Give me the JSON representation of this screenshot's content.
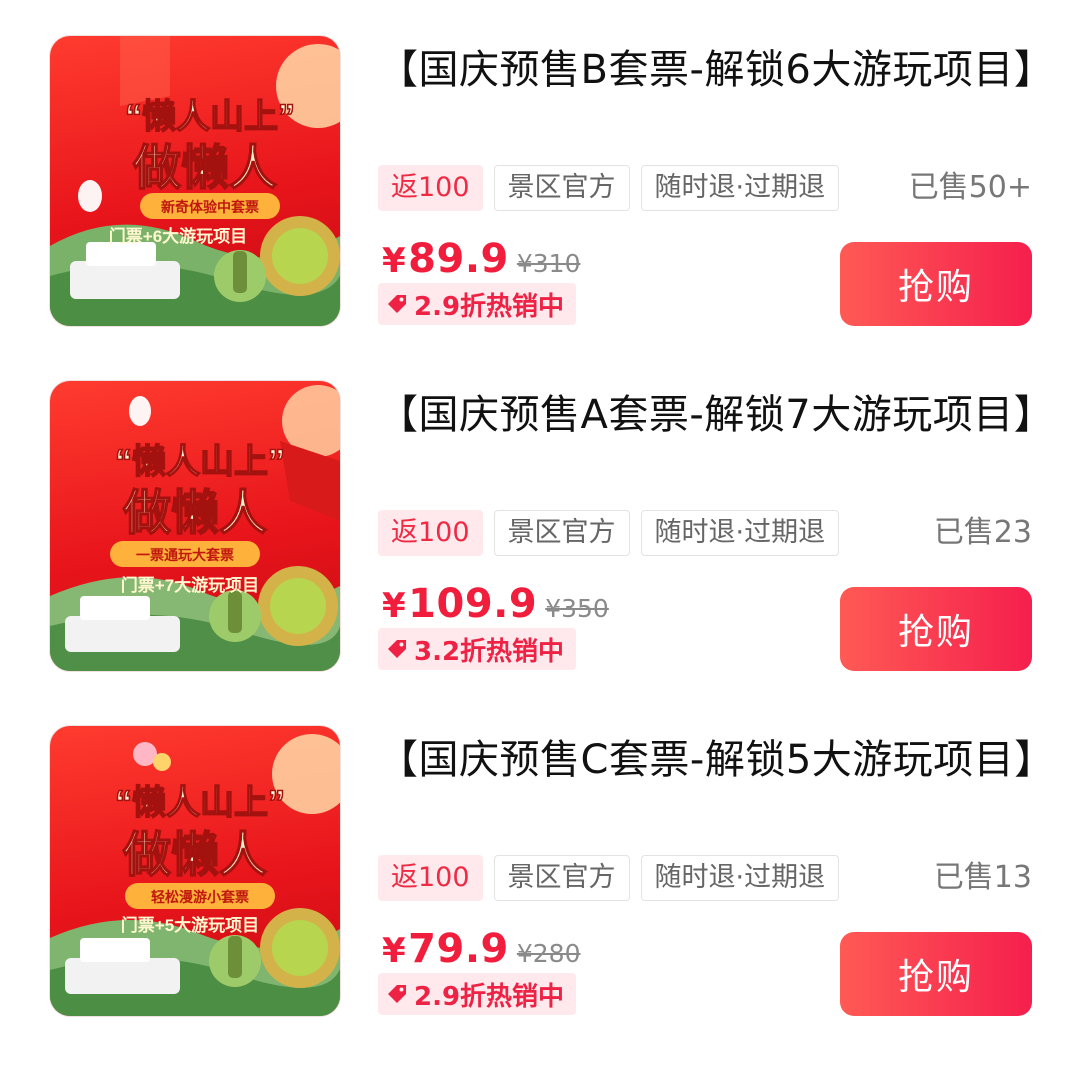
{
  "products": [
    {
      "title": "【国庆预售B套票-解锁6大游玩项目】",
      "image": {
        "headline_1": "“懒人山上”",
        "headline_2": "做懒人",
        "subtitle": "新奇体验中套票",
        "ribbon": "门票+6大游玩项目"
      },
      "tags": [
        "返100",
        "景区官方",
        "随时退·过期退"
      ],
      "sold": "已售50+",
      "price_symbol": "¥",
      "price": "89.9",
      "original_price": "¥310",
      "discount": "2.9折热销中",
      "buy_label": "抢购"
    },
    {
      "title": "【国庆预售A套票-解锁7大游玩项目】",
      "image": {
        "headline_1": "“懒人山上”",
        "headline_2": "做懒人",
        "subtitle": "一票通玩大套票",
        "ribbon": "门票+7大游玩项目"
      },
      "tags": [
        "返100",
        "景区官方",
        "随时退·过期退"
      ],
      "sold": "已售23",
      "price_symbol": "¥",
      "price": "109.9",
      "original_price": "¥350",
      "discount": "3.2折热销中",
      "buy_label": "抢购"
    },
    {
      "title": "【国庆预售C套票-解锁5大游玩项目】",
      "image": {
        "headline_1": "“懒人山上”",
        "headline_2": "做懒人",
        "subtitle": "轻松漫游小套票",
        "ribbon": "门票+5大游玩项目"
      },
      "tags": [
        "返100",
        "景区官方",
        "随时退·过期退"
      ],
      "sold": "已售13",
      "price_symbol": "¥",
      "price": "79.9",
      "original_price": "¥280",
      "discount": "2.9折热销中",
      "buy_label": "抢购"
    }
  ],
  "colors": {
    "accent": "#f01e3c",
    "button_from": "#ff5a55",
    "button_to": "#f51f4d",
    "tag_bg": "#ffe9ec"
  }
}
